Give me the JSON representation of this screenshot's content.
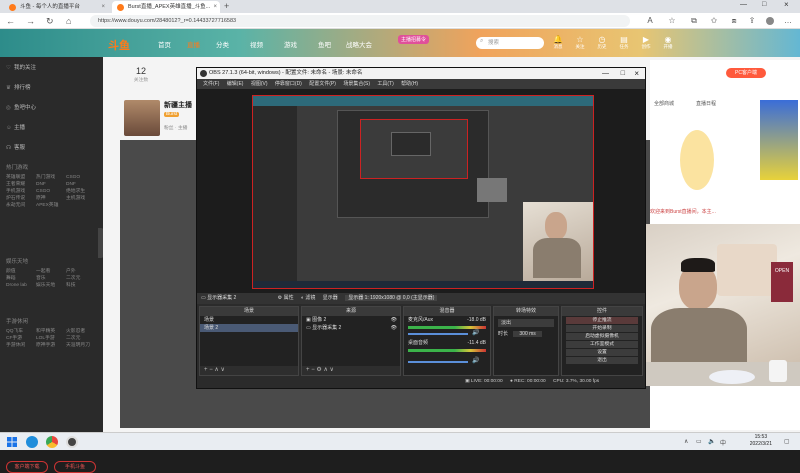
{
  "browser": {
    "tabs": [
      {
        "title": "斗鱼 - 每个人的直播平台"
      },
      {
        "title": "Burst直播_APEX英雄直播_斗鱼..."
      }
    ],
    "url": "https://www.douyu.com/2848012?_r=0.14433727716583"
  },
  "douyu": {
    "logo": "斗鱼",
    "nav": [
      "首页",
      "直播",
      "分类",
      "视频",
      "游戏",
      "鱼吧",
      "战略大会"
    ],
    "nav_active_index": 1,
    "promo": "主播招募令",
    "search_placeholder": "搜索",
    "header_icons": [
      {
        "icon": "bell-icon",
        "label": "消息"
      },
      {
        "icon": "star-icon",
        "label": "关注"
      },
      {
        "icon": "history-icon",
        "label": "历史"
      },
      {
        "icon": "chart-icon",
        "label": "任务"
      },
      {
        "icon": "video-icon",
        "label": "创作"
      },
      {
        "icon": "live-icon",
        "label": "开播"
      }
    ],
    "sidebar": {
      "items": [
        "我的关注",
        "排行榜",
        "鱼吧中心",
        "主播",
        "客服"
      ],
      "sections": [
        {
          "title": "热门游戏",
          "tags": [
            "英雄联盟",
            "热门游戏",
            "CSGO",
            "王者荣耀",
            "DNF",
            "DNF",
            "手机游戏",
            "CSGO",
            "绝地求生",
            "炉石传说",
            "原神",
            "主机游戏",
            "永劫无间",
            "APEX英雄"
          ]
        },
        {
          "title": "娱乐天地",
          "tags": [
            "颜值",
            "一起看",
            "户外",
            "舞蹈",
            "音乐",
            "二次元",
            "Drone lab",
            "娱乐天地",
            "科技"
          ]
        },
        {
          "title": "手游休闲",
          "tags": [
            "QQ飞车",
            "和平精英",
            "火影忍者",
            "CF手游",
            "LOL手游",
            "二次元",
            "手游休闲",
            "原神手游",
            "天涯明月刀"
          ]
        }
      ],
      "buttons": [
        "客户端下载",
        "手机斗鱼"
      ]
    },
    "streamer": {
      "name": "新疆主播",
      "level": "Burst",
      "sub": "粉丝 · 主播"
    },
    "counter": {
      "value": "12",
      "label": "关注数"
    },
    "right_buttons": [
      "PC客户端",
      "全部商城",
      "直播日程"
    ],
    "right_text": "欢迎来到Burst直播间，本主...",
    "ad_label": "OPEN"
  },
  "obs": {
    "title": "OBS 27.1.3 (64-bit, windows) - 配置文件: 未命名 - 场景: 未命名",
    "menu": [
      "文件(F)",
      "编辑(E)",
      "视图(V)",
      "停靠窗口(D)",
      "配置文件(P)",
      "场景集合(S)",
      "工具(T)",
      "帮助(H)"
    ],
    "toolbar": [
      "显示器采集 2",
      "属性",
      "滤镜",
      "显示器",
      "显示器 1: 1920x1080 @ 0,0 (主显示器)"
    ],
    "docks": {
      "scenes": {
        "title": "场景",
        "rows": [
          "场景",
          "场景 2"
        ]
      },
      "sources": {
        "title": "来源",
        "rows": [
          "图像 2",
          "显示器采集 2"
        ]
      },
      "mixer": {
        "title": "混音器",
        "channels": [
          {
            "name": "麦克风/Aux",
            "db": "-18.0 dB"
          },
          {
            "name": "桌面音频",
            "db": "-11.4 dB"
          }
        ]
      },
      "transitions": {
        "title": "转场特效",
        "effect": "淡出",
        "duration_label": "时长",
        "duration": "300 ms"
      },
      "controls": {
        "title": "控件",
        "buttons": [
          "停止推流",
          "开始录制",
          "启动虚拟摄像机",
          "工作室模式",
          "设置",
          "退出"
        ]
      }
    },
    "status": {
      "live": "LIVE: 00:00:00",
      "rec": "REC: 00:00:00",
      "cpu": "CPU: 3.7%, 30.00 fps"
    }
  },
  "taskbar": {
    "time": "15:53",
    "date": "2022/3/21",
    "apps": [
      {
        "icon": "windows-icon",
        "color": "#1a73e8"
      },
      {
        "icon": "edge-icon",
        "color": "#1f8ddb"
      },
      {
        "icon": "chrome-icon",
        "color": "#e8453c"
      },
      {
        "icon": "obs-icon",
        "color": "#444444"
      }
    ]
  }
}
